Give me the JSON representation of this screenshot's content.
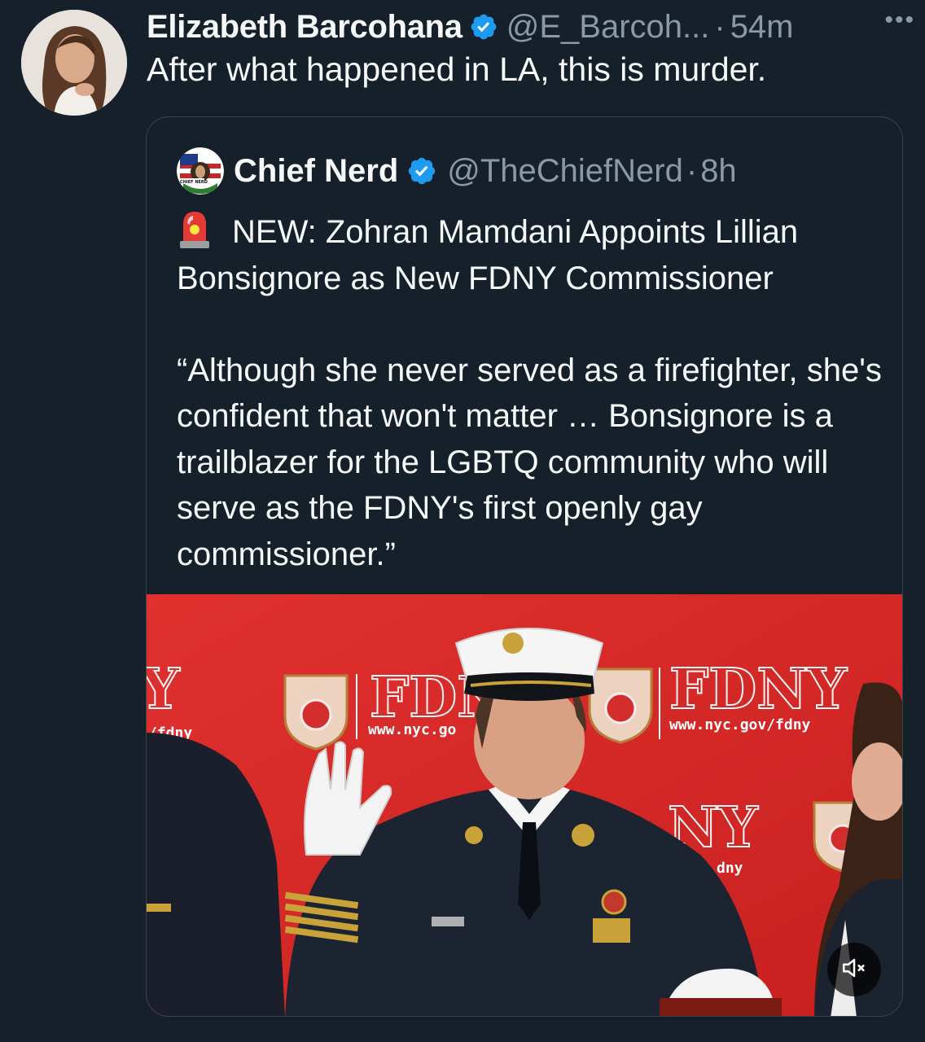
{
  "tweet": {
    "author_name": "Elizabeth Barcohana",
    "author_handle": "@E_Barcoh...",
    "separator": "·",
    "time": "54m",
    "more_label": "•••",
    "text": "After what happened in LA, this is murder."
  },
  "quoted_tweet": {
    "author_name": "Chief Nerd",
    "author_handle": "@TheChiefNerd",
    "separator": "·",
    "time": "8h",
    "avatar_label": "CHIEF NERD",
    "line1": "NEW: Zohran Mamdani Appoints Lillian Bonsignore as New FDNY Commissioner",
    "quote": "“Although she never served as a firefighter, she's confident that won't matter … Bonsignore is a trailblazer for the LGBTQ community who will serve as the FDNY's first openly gay commissioner.”",
    "media": {
      "backdrop_fdny_left": "FDN",
      "backdrop_fdny_right": "FDNY",
      "backdrop_url_left": "www.nyc.go",
      "backdrop_url_right": "www.nyc.gov/fdny",
      "backdrop_edge_left": "Y",
      "backdrop_edge_left_url": "/fdny",
      "backdrop_mid": "NY",
      "backdrop_mid_url": "dny",
      "mute_icon": "speaker-muted-icon"
    }
  },
  "colors": {
    "background": "#15202b",
    "text_primary": "#f7f9f9",
    "text_secondary": "#8b98a5",
    "verified_blue": "#1d9bf0",
    "border": "#38444d",
    "backdrop_red": "#d62b2b"
  }
}
